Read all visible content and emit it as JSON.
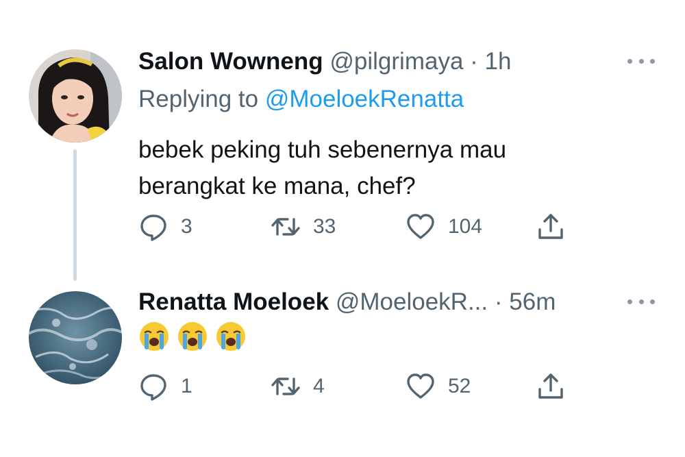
{
  "tweets": [
    {
      "name": "Salon Wowneng",
      "handle": "@pilgrimaya",
      "dot": "·",
      "time": "1h",
      "replying_prefix": "Replying to ",
      "replying_to": "@MoeloekRenatta",
      "text_line1": "bebek peking tuh sebenernya mau",
      "text_line2": "berangkat ke mana, chef?",
      "replies": "3",
      "retweets": "33",
      "likes": "104"
    },
    {
      "name": "Renatta Moeloek",
      "handle": "@MoeloekR...",
      "dot": "·",
      "time": "56m",
      "text_emoji": [
        "😭",
        "😭",
        "😭"
      ],
      "replies": "1",
      "retweets": "4",
      "likes": "52"
    }
  ],
  "icons": {
    "reply": "speech-bubble-icon",
    "retweet": "retweet-arrows-icon",
    "like": "heart-icon",
    "share": "share-upload-icon",
    "more": "more-dots-icon"
  },
  "colors": {
    "text": "#0f1419",
    "secondary": "#536471",
    "link": "#1d9bf0",
    "thread_line": "#cfd9de"
  }
}
